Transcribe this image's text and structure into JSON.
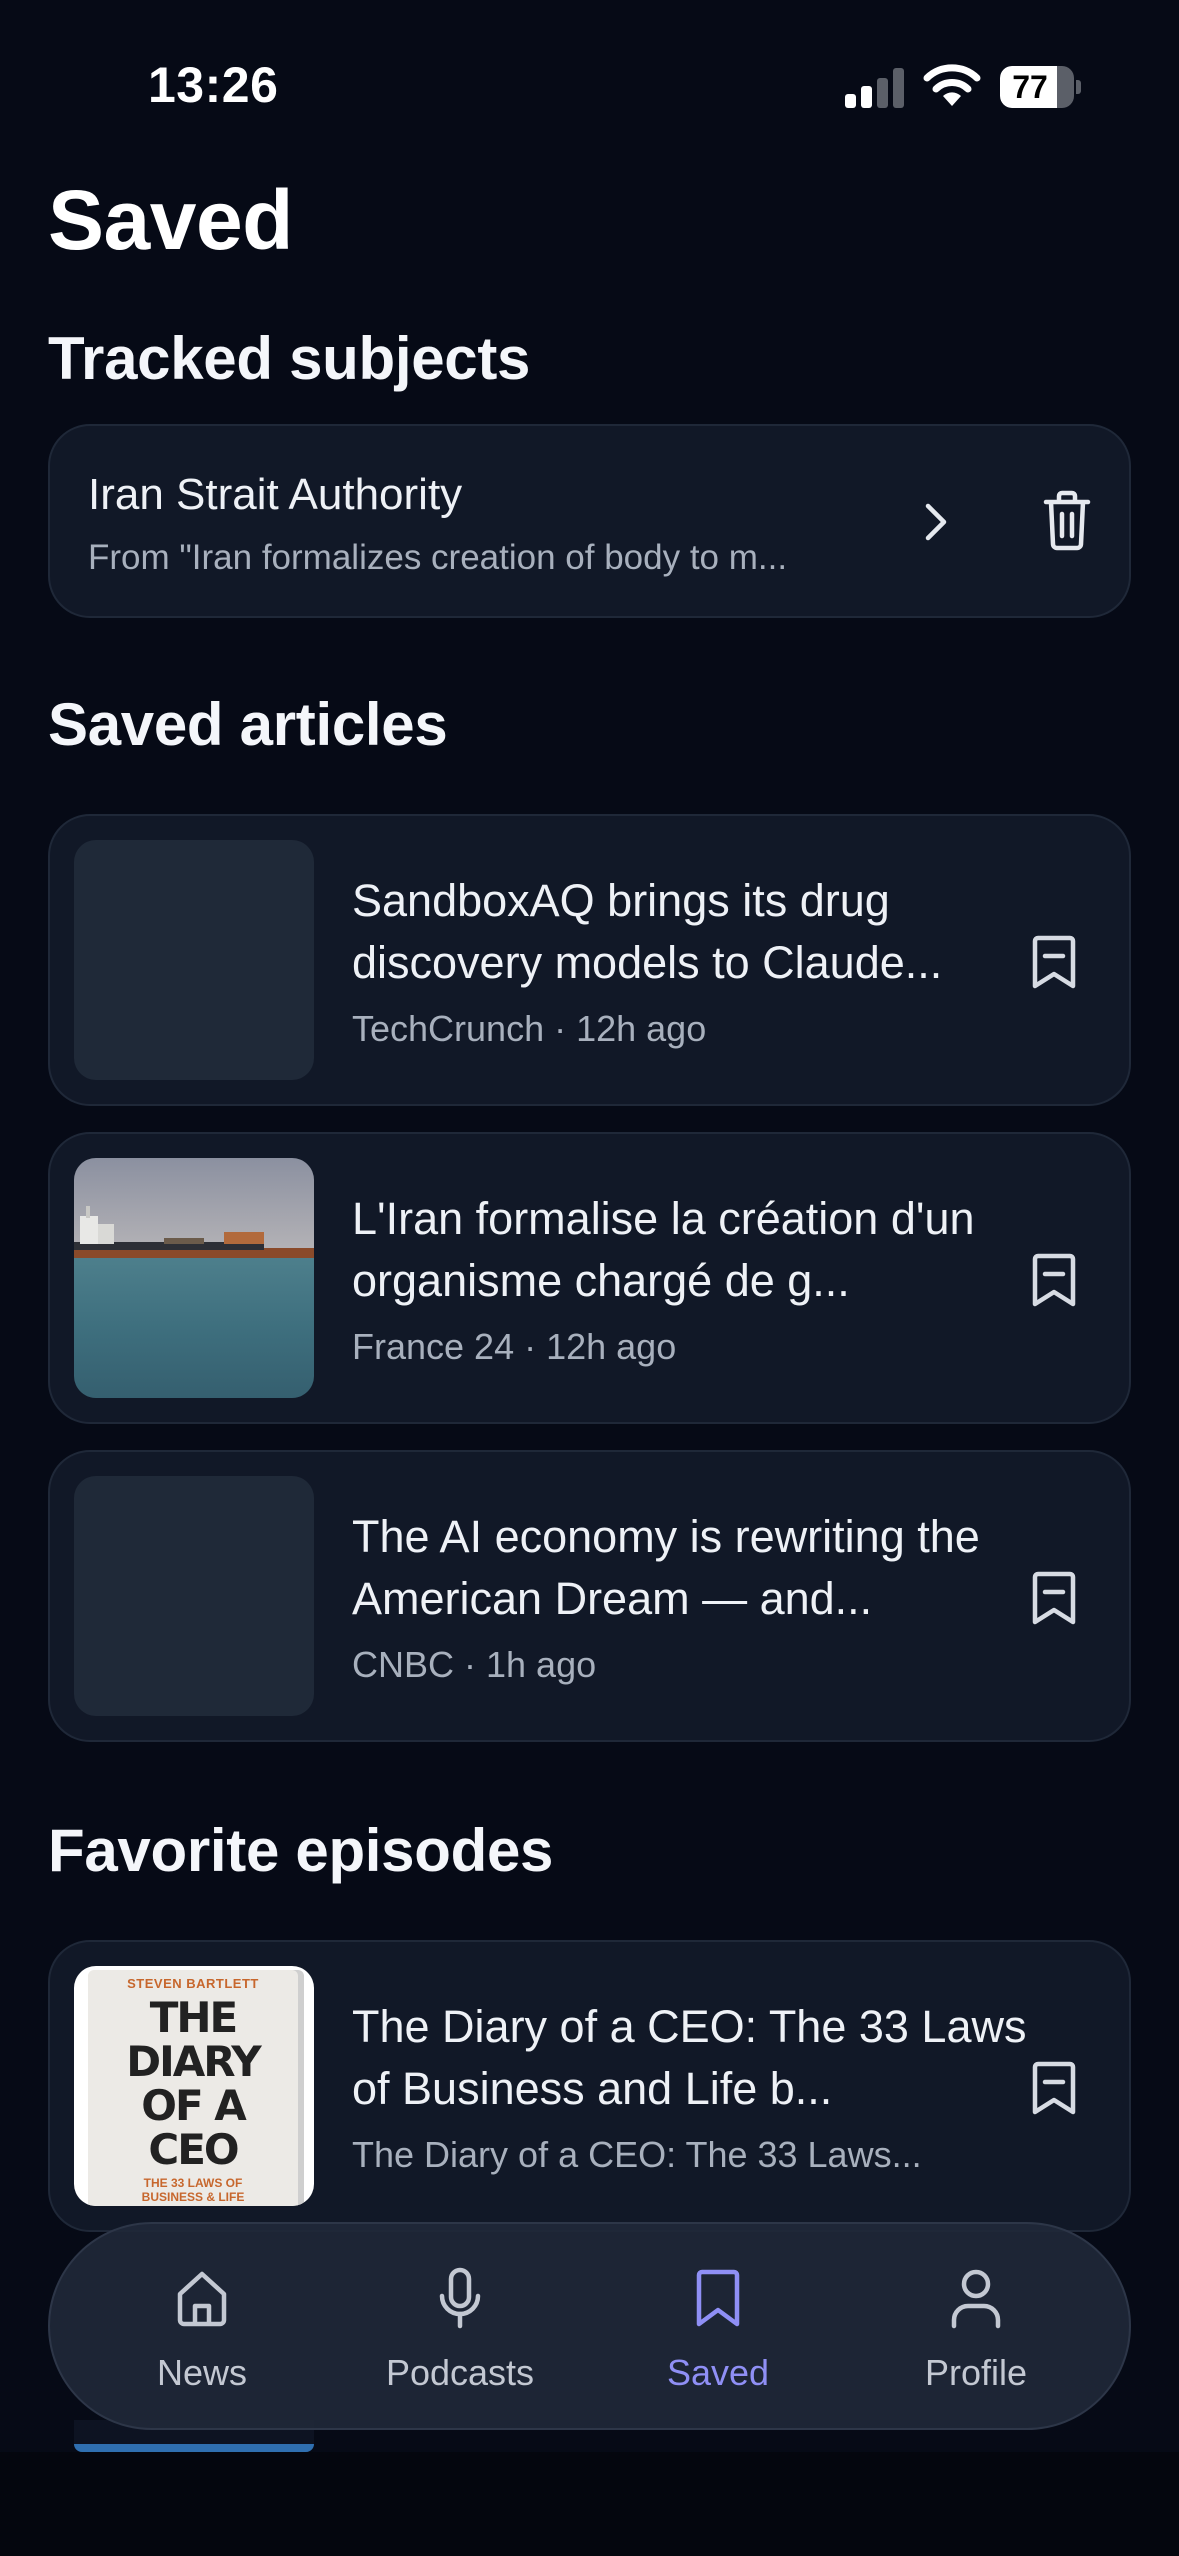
{
  "status_bar": {
    "time": "13:26",
    "battery": "77",
    "battery_level": 0.77,
    "signal_bars": 2
  },
  "page": {
    "title": "Saved"
  },
  "tracked": {
    "section_title": "Tracked subjects",
    "items": [
      {
        "name": "Iran Strait Authority",
        "subtitle": "From \"Iran formalizes creation of body to m..."
      }
    ]
  },
  "articles": {
    "section_title": "Saved articles",
    "items": [
      {
        "title": "SandboxAQ brings its drug discovery models to Claude...",
        "meta": "TechCrunch · 12h ago",
        "thumbnail": "placeholder"
      },
      {
        "title": "L'Iran formalise la création d'un organisme chargé de g...",
        "meta": "France 24 · 12h ago",
        "thumbnail": "ship-at-sea"
      },
      {
        "title": "The AI economy is rewriting the American Dream — and...",
        "meta": "CNBC · 1h ago",
        "thumbnail": "placeholder"
      }
    ]
  },
  "episodes": {
    "section_title": "Favorite episodes",
    "items": [
      {
        "title": "The Diary of a CEO: The 33 Laws of Business and Life b...",
        "meta": "The Diary of a CEO: The 33 Laws...",
        "cover": {
          "author": "STEVEN BARTLETT",
          "title_lines": [
            "THE",
            "DIARY",
            "OF A",
            "CEO"
          ],
          "subtitle_lines": [
            "THE 33 LAWS OF",
            "BUSINESS & LIFE"
          ]
        }
      }
    ]
  },
  "tab_bar": {
    "tabs": [
      {
        "label": "News",
        "icon": "home-icon"
      },
      {
        "label": "Podcasts",
        "icon": "microphone-icon"
      },
      {
        "label": "Saved",
        "icon": "bookmark-icon",
        "active": true
      },
      {
        "label": "Profile",
        "icon": "person-icon"
      }
    ]
  },
  "colors": {
    "background": "#060a16",
    "card": "#111827",
    "accent": "#8f8ff5",
    "muted_text": "#a8b0bd"
  }
}
